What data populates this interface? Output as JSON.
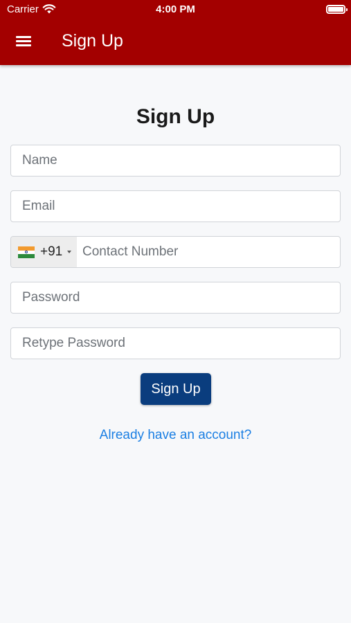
{
  "status_bar": {
    "carrier": "Carrier",
    "time": "4:00 PM"
  },
  "header": {
    "title": "Sign Up",
    "background_color": "#a30000"
  },
  "form": {
    "title": "Sign Up",
    "name_placeholder": "Name",
    "email_placeholder": "Email",
    "phone": {
      "country_flag": "india-flag-icon",
      "dial_code": "+91",
      "placeholder": "Contact Number"
    },
    "password_placeholder": "Password",
    "retype_password_placeholder": "Retype Password",
    "submit_label": "Sign Up",
    "submit_color": "#0a3d7e",
    "login_link": "Already have an account?",
    "link_color": "#1b7fe3"
  }
}
